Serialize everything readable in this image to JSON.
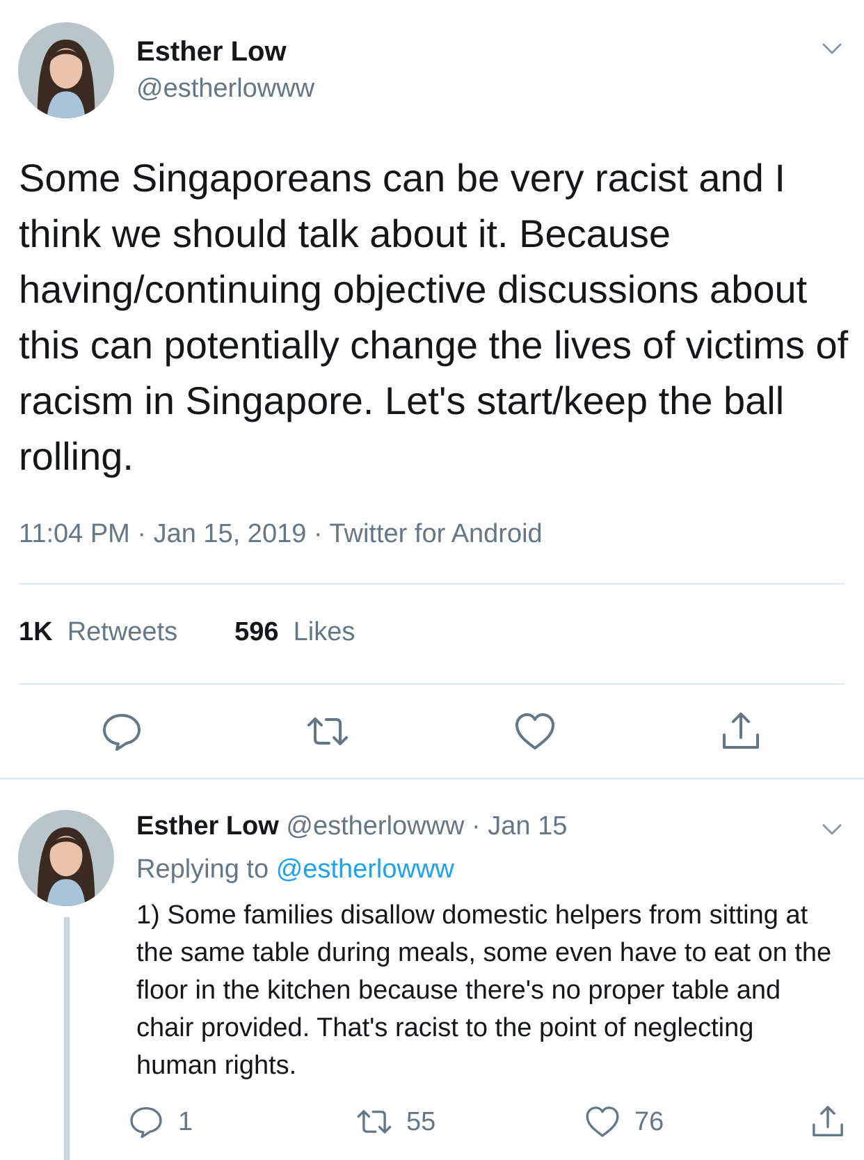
{
  "tweet": {
    "author_name": "Esther Low",
    "author_handle": "@estherlowww",
    "text": "Some Singaporeans can be very racist and I think we should talk about it. Because having/continuing objective discussions about this can potentially change the lives of victims of racism in Singapore. Let's start/keep the ball rolling.",
    "meta": "11:04 PM · Jan 15, 2019 · Twitter for Android",
    "retweets_count": "1K",
    "retweets_label": "Retweets",
    "likes_count": "596",
    "likes_label": "Likes",
    "actions": [
      "reply-icon",
      "retweet-icon",
      "like-icon",
      "share-icon"
    ]
  },
  "reply": {
    "author_name": "Esther Low",
    "author_handle": "@estherlowww",
    "separator": "·",
    "date": "Jan 15",
    "replying_prefix": "Replying to",
    "replying_to": "@estherlowww",
    "text": "1) Some families disallow domestic helpers from sitting at the same table during meals, some even have to eat on the floor in the kitchen because there's no proper table and chair provided. That's racist to the point of neglecting human rights.",
    "reply_count": "1",
    "retweet_count": "55",
    "like_count": "76"
  },
  "colors": {
    "text": "#14171a",
    "secondary": "#657786",
    "link": "#1da1f2",
    "divider": "#e1e8ed",
    "thread_line": "#ccd6dd"
  }
}
